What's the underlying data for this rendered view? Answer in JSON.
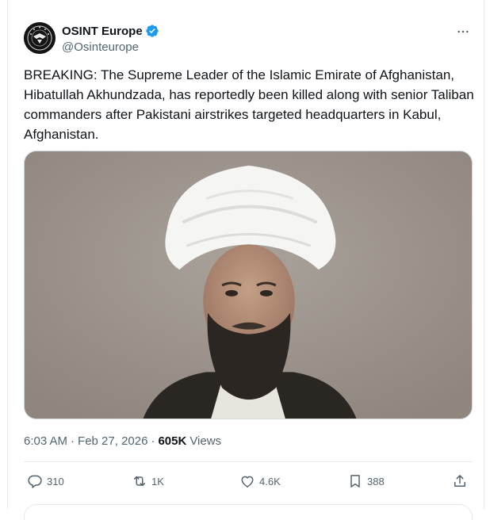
{
  "author": {
    "display_name": "OSINT Europe",
    "handle": "@Osinteurope",
    "verified": true,
    "avatar_icon": "osint-europe-logo",
    "more_icon": "more-horizontal-icon"
  },
  "tweet": {
    "text": "BREAKING: The Supreme Leader of the Islamic Emirate of Afghanistan, Hibatullah Akhundzada, has reportedly been killed along with senior Taliban commanders after Pakistani airstrikes targeted headquarters in Kabul, Afghanistan.",
    "media_kind": "photo"
  },
  "meta": {
    "time": "6:03 AM",
    "separator": "·",
    "date": "Feb 27, 2026",
    "views_count": "605K",
    "views_label": "Views"
  },
  "actions": {
    "reply_count": "310",
    "repost_count": "1K",
    "like_count": "4.6K",
    "bookmark_count": "388"
  },
  "colors": {
    "text": "#0f1419",
    "secondary": "#536471",
    "verified": "#1d9bf0",
    "border": "#e7e9ea"
  }
}
